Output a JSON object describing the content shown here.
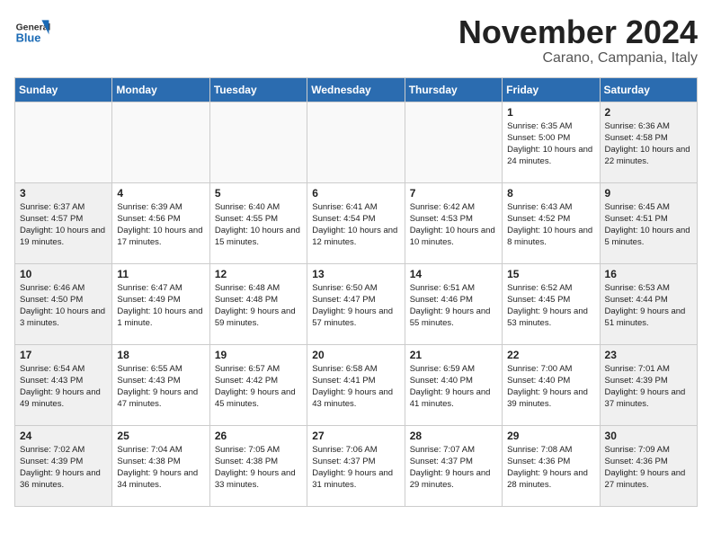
{
  "header": {
    "logo_general": "General",
    "logo_blue": "Blue",
    "month_title": "November 2024",
    "location": "Carano, Campania, Italy"
  },
  "weekdays": [
    "Sunday",
    "Monday",
    "Tuesday",
    "Wednesday",
    "Thursday",
    "Friday",
    "Saturday"
  ],
  "weeks": [
    [
      {
        "day": "",
        "info": ""
      },
      {
        "day": "",
        "info": ""
      },
      {
        "day": "",
        "info": ""
      },
      {
        "day": "",
        "info": ""
      },
      {
        "day": "",
        "info": ""
      },
      {
        "day": "1",
        "info": "Sunrise: 6:35 AM\nSunset: 5:00 PM\nDaylight: 10 hours and 24 minutes."
      },
      {
        "day": "2",
        "info": "Sunrise: 6:36 AM\nSunset: 4:58 PM\nDaylight: 10 hours and 22 minutes."
      }
    ],
    [
      {
        "day": "3",
        "info": "Sunrise: 6:37 AM\nSunset: 4:57 PM\nDaylight: 10 hours and 19 minutes."
      },
      {
        "day": "4",
        "info": "Sunrise: 6:39 AM\nSunset: 4:56 PM\nDaylight: 10 hours and 17 minutes."
      },
      {
        "day": "5",
        "info": "Sunrise: 6:40 AM\nSunset: 4:55 PM\nDaylight: 10 hours and 15 minutes."
      },
      {
        "day": "6",
        "info": "Sunrise: 6:41 AM\nSunset: 4:54 PM\nDaylight: 10 hours and 12 minutes."
      },
      {
        "day": "7",
        "info": "Sunrise: 6:42 AM\nSunset: 4:53 PM\nDaylight: 10 hours and 10 minutes."
      },
      {
        "day": "8",
        "info": "Sunrise: 6:43 AM\nSunset: 4:52 PM\nDaylight: 10 hours and 8 minutes."
      },
      {
        "day": "9",
        "info": "Sunrise: 6:45 AM\nSunset: 4:51 PM\nDaylight: 10 hours and 5 minutes."
      }
    ],
    [
      {
        "day": "10",
        "info": "Sunrise: 6:46 AM\nSunset: 4:50 PM\nDaylight: 10 hours and 3 minutes."
      },
      {
        "day": "11",
        "info": "Sunrise: 6:47 AM\nSunset: 4:49 PM\nDaylight: 10 hours and 1 minute."
      },
      {
        "day": "12",
        "info": "Sunrise: 6:48 AM\nSunset: 4:48 PM\nDaylight: 9 hours and 59 minutes."
      },
      {
        "day": "13",
        "info": "Sunrise: 6:50 AM\nSunset: 4:47 PM\nDaylight: 9 hours and 57 minutes."
      },
      {
        "day": "14",
        "info": "Sunrise: 6:51 AM\nSunset: 4:46 PM\nDaylight: 9 hours and 55 minutes."
      },
      {
        "day": "15",
        "info": "Sunrise: 6:52 AM\nSunset: 4:45 PM\nDaylight: 9 hours and 53 minutes."
      },
      {
        "day": "16",
        "info": "Sunrise: 6:53 AM\nSunset: 4:44 PM\nDaylight: 9 hours and 51 minutes."
      }
    ],
    [
      {
        "day": "17",
        "info": "Sunrise: 6:54 AM\nSunset: 4:43 PM\nDaylight: 9 hours and 49 minutes."
      },
      {
        "day": "18",
        "info": "Sunrise: 6:55 AM\nSunset: 4:43 PM\nDaylight: 9 hours and 47 minutes."
      },
      {
        "day": "19",
        "info": "Sunrise: 6:57 AM\nSunset: 4:42 PM\nDaylight: 9 hours and 45 minutes."
      },
      {
        "day": "20",
        "info": "Sunrise: 6:58 AM\nSunset: 4:41 PM\nDaylight: 9 hours and 43 minutes."
      },
      {
        "day": "21",
        "info": "Sunrise: 6:59 AM\nSunset: 4:40 PM\nDaylight: 9 hours and 41 minutes."
      },
      {
        "day": "22",
        "info": "Sunrise: 7:00 AM\nSunset: 4:40 PM\nDaylight: 9 hours and 39 minutes."
      },
      {
        "day": "23",
        "info": "Sunrise: 7:01 AM\nSunset: 4:39 PM\nDaylight: 9 hours and 37 minutes."
      }
    ],
    [
      {
        "day": "24",
        "info": "Sunrise: 7:02 AM\nSunset: 4:39 PM\nDaylight: 9 hours and 36 minutes."
      },
      {
        "day": "25",
        "info": "Sunrise: 7:04 AM\nSunset: 4:38 PM\nDaylight: 9 hours and 34 minutes."
      },
      {
        "day": "26",
        "info": "Sunrise: 7:05 AM\nSunset: 4:38 PM\nDaylight: 9 hours and 33 minutes."
      },
      {
        "day": "27",
        "info": "Sunrise: 7:06 AM\nSunset: 4:37 PM\nDaylight: 9 hours and 31 minutes."
      },
      {
        "day": "28",
        "info": "Sunrise: 7:07 AM\nSunset: 4:37 PM\nDaylight: 9 hours and 29 minutes."
      },
      {
        "day": "29",
        "info": "Sunrise: 7:08 AM\nSunset: 4:36 PM\nDaylight: 9 hours and 28 minutes."
      },
      {
        "day": "30",
        "info": "Sunrise: 7:09 AM\nSunset: 4:36 PM\nDaylight: 9 hours and 27 minutes."
      }
    ]
  ]
}
